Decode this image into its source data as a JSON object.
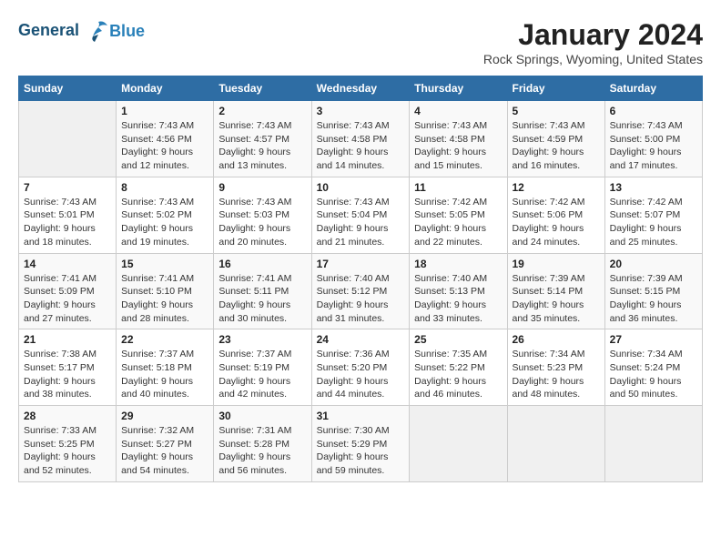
{
  "header": {
    "logo_line1": "General",
    "logo_line2": "Blue",
    "month_year": "January 2024",
    "location": "Rock Springs, Wyoming, United States"
  },
  "days_of_week": [
    "Sunday",
    "Monday",
    "Tuesday",
    "Wednesday",
    "Thursday",
    "Friday",
    "Saturday"
  ],
  "weeks": [
    [
      {
        "day": "",
        "info": ""
      },
      {
        "day": "1",
        "info": "Sunrise: 7:43 AM\nSunset: 4:56 PM\nDaylight: 9 hours\nand 12 minutes."
      },
      {
        "day": "2",
        "info": "Sunrise: 7:43 AM\nSunset: 4:57 PM\nDaylight: 9 hours\nand 13 minutes."
      },
      {
        "day": "3",
        "info": "Sunrise: 7:43 AM\nSunset: 4:58 PM\nDaylight: 9 hours\nand 14 minutes."
      },
      {
        "day": "4",
        "info": "Sunrise: 7:43 AM\nSunset: 4:58 PM\nDaylight: 9 hours\nand 15 minutes."
      },
      {
        "day": "5",
        "info": "Sunrise: 7:43 AM\nSunset: 4:59 PM\nDaylight: 9 hours\nand 16 minutes."
      },
      {
        "day": "6",
        "info": "Sunrise: 7:43 AM\nSunset: 5:00 PM\nDaylight: 9 hours\nand 17 minutes."
      }
    ],
    [
      {
        "day": "7",
        "info": "Sunrise: 7:43 AM\nSunset: 5:01 PM\nDaylight: 9 hours\nand 18 minutes."
      },
      {
        "day": "8",
        "info": "Sunrise: 7:43 AM\nSunset: 5:02 PM\nDaylight: 9 hours\nand 19 minutes."
      },
      {
        "day": "9",
        "info": "Sunrise: 7:43 AM\nSunset: 5:03 PM\nDaylight: 9 hours\nand 20 minutes."
      },
      {
        "day": "10",
        "info": "Sunrise: 7:43 AM\nSunset: 5:04 PM\nDaylight: 9 hours\nand 21 minutes."
      },
      {
        "day": "11",
        "info": "Sunrise: 7:42 AM\nSunset: 5:05 PM\nDaylight: 9 hours\nand 22 minutes."
      },
      {
        "day": "12",
        "info": "Sunrise: 7:42 AM\nSunset: 5:06 PM\nDaylight: 9 hours\nand 24 minutes."
      },
      {
        "day": "13",
        "info": "Sunrise: 7:42 AM\nSunset: 5:07 PM\nDaylight: 9 hours\nand 25 minutes."
      }
    ],
    [
      {
        "day": "14",
        "info": "Sunrise: 7:41 AM\nSunset: 5:09 PM\nDaylight: 9 hours\nand 27 minutes."
      },
      {
        "day": "15",
        "info": "Sunrise: 7:41 AM\nSunset: 5:10 PM\nDaylight: 9 hours\nand 28 minutes."
      },
      {
        "day": "16",
        "info": "Sunrise: 7:41 AM\nSunset: 5:11 PM\nDaylight: 9 hours\nand 30 minutes."
      },
      {
        "day": "17",
        "info": "Sunrise: 7:40 AM\nSunset: 5:12 PM\nDaylight: 9 hours\nand 31 minutes."
      },
      {
        "day": "18",
        "info": "Sunrise: 7:40 AM\nSunset: 5:13 PM\nDaylight: 9 hours\nand 33 minutes."
      },
      {
        "day": "19",
        "info": "Sunrise: 7:39 AM\nSunset: 5:14 PM\nDaylight: 9 hours\nand 35 minutes."
      },
      {
        "day": "20",
        "info": "Sunrise: 7:39 AM\nSunset: 5:15 PM\nDaylight: 9 hours\nand 36 minutes."
      }
    ],
    [
      {
        "day": "21",
        "info": "Sunrise: 7:38 AM\nSunset: 5:17 PM\nDaylight: 9 hours\nand 38 minutes."
      },
      {
        "day": "22",
        "info": "Sunrise: 7:37 AM\nSunset: 5:18 PM\nDaylight: 9 hours\nand 40 minutes."
      },
      {
        "day": "23",
        "info": "Sunrise: 7:37 AM\nSunset: 5:19 PM\nDaylight: 9 hours\nand 42 minutes."
      },
      {
        "day": "24",
        "info": "Sunrise: 7:36 AM\nSunset: 5:20 PM\nDaylight: 9 hours\nand 44 minutes."
      },
      {
        "day": "25",
        "info": "Sunrise: 7:35 AM\nSunset: 5:22 PM\nDaylight: 9 hours\nand 46 minutes."
      },
      {
        "day": "26",
        "info": "Sunrise: 7:34 AM\nSunset: 5:23 PM\nDaylight: 9 hours\nand 48 minutes."
      },
      {
        "day": "27",
        "info": "Sunrise: 7:34 AM\nSunset: 5:24 PM\nDaylight: 9 hours\nand 50 minutes."
      }
    ],
    [
      {
        "day": "28",
        "info": "Sunrise: 7:33 AM\nSunset: 5:25 PM\nDaylight: 9 hours\nand 52 minutes."
      },
      {
        "day": "29",
        "info": "Sunrise: 7:32 AM\nSunset: 5:27 PM\nDaylight: 9 hours\nand 54 minutes."
      },
      {
        "day": "30",
        "info": "Sunrise: 7:31 AM\nSunset: 5:28 PM\nDaylight: 9 hours\nand 56 minutes."
      },
      {
        "day": "31",
        "info": "Sunrise: 7:30 AM\nSunset: 5:29 PM\nDaylight: 9 hours\nand 59 minutes."
      },
      {
        "day": "",
        "info": ""
      },
      {
        "day": "",
        "info": ""
      },
      {
        "day": "",
        "info": ""
      }
    ]
  ]
}
